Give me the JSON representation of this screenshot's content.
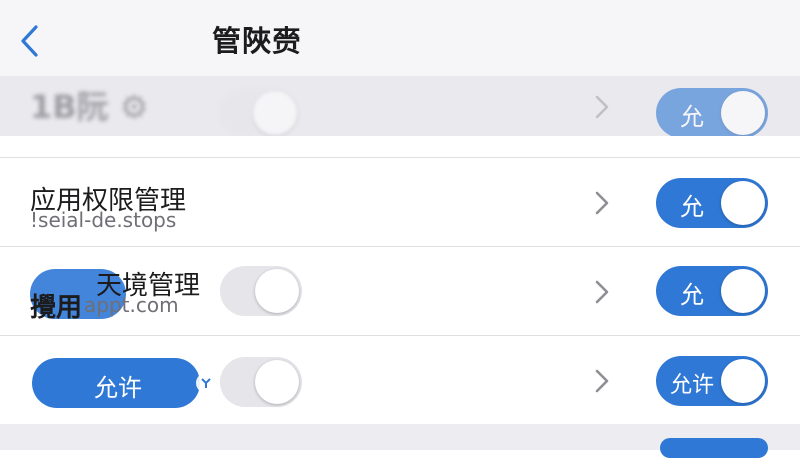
{
  "navbar": {
    "back_icon": "chevron-left-icon",
    "title": "管陜赍"
  },
  "rows": [
    {
      "label": "1B阮 ⚙",
      "sub": "",
      "toggle_label": "允"
    },
    {
      "label": "应用权限管理",
      "sub": "!seial-de.stops",
      "toggle_label": "允"
    },
    {
      "label": "天境管理",
      "sub": "appt.com",
      "prefix": "攪用",
      "toggle_label": "允"
    },
    {
      "label": "",
      "pill_label": "允许",
      "toggle_label": "允许"
    }
  ],
  "colors": {
    "accent": "#2f78d6",
    "toggle_off": "#e5e5ea",
    "background": "#ffffff",
    "navbar": "#f6f6f8"
  }
}
